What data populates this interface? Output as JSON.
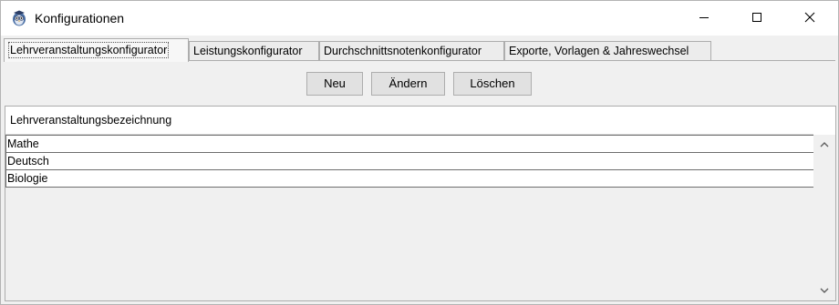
{
  "window": {
    "title": "Konfigurationen",
    "icon": "owl-app-icon",
    "controls": [
      "minimize-icon",
      "maximize-icon",
      "close-icon"
    ]
  },
  "tabs": [
    {
      "label": "Lehrveranstaltungskonfigurator",
      "active": true
    },
    {
      "label": "Leistungskonfigurator",
      "active": false
    },
    {
      "label": "Durchschnittsnotenkonfigurator",
      "active": false
    },
    {
      "label": "Exporte, Vorlagen & Jahreswechsel",
      "active": false
    }
  ],
  "toolbar": {
    "new_label": "Neu",
    "edit_label": "Ändern",
    "delete_label": "Löschen"
  },
  "table": {
    "header": "Lehrveranstaltungsbezeichnung",
    "rows": [
      "Mathe",
      "Deutsch",
      "Biologie"
    ]
  }
}
